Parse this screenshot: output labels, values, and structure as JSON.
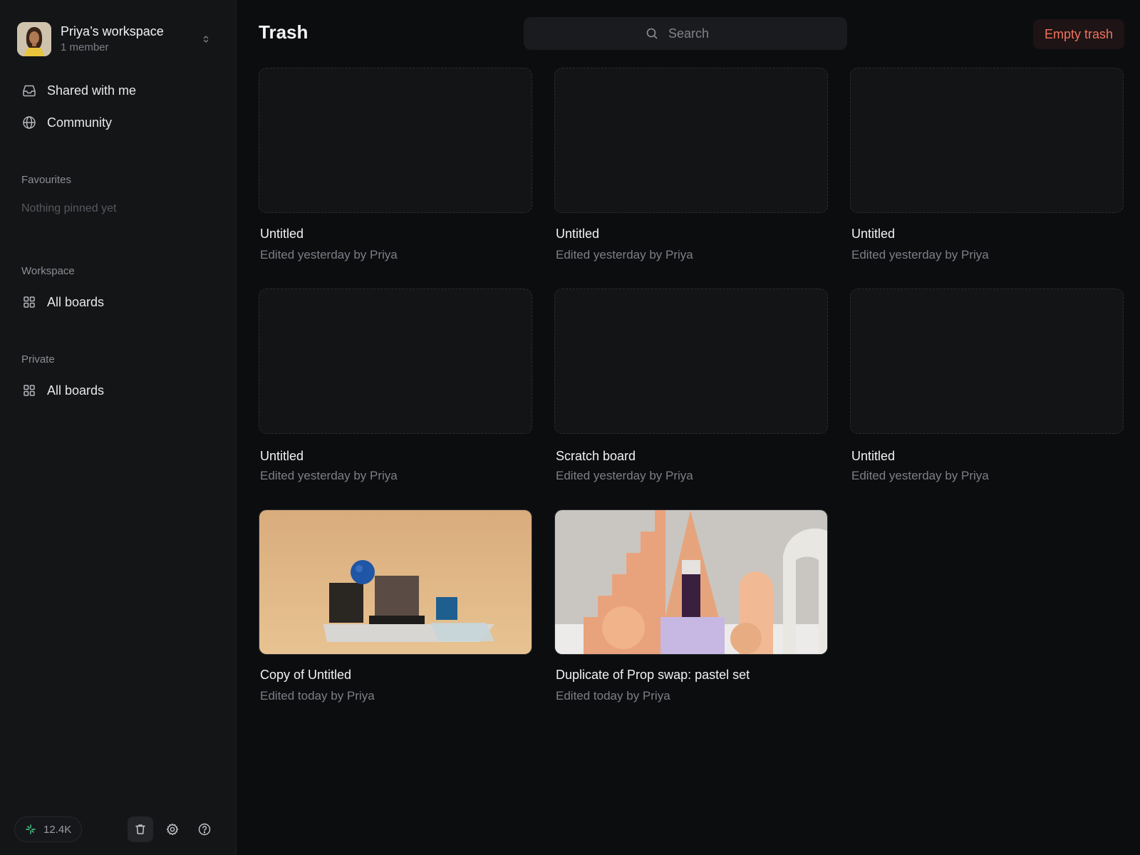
{
  "workspace": {
    "name": "Priya’s workspace",
    "members": "1 member"
  },
  "nav": {
    "shared": "Shared with me",
    "community": "Community"
  },
  "favourites": {
    "label": "Favourites",
    "empty": "Nothing pinned yet"
  },
  "workspace_section": {
    "label": "Workspace",
    "all_boards": "All boards"
  },
  "private_section": {
    "label": "Private",
    "all_boards": "All boards"
  },
  "footer": {
    "credits": "12.4K"
  },
  "header": {
    "title": "Trash",
    "search_placeholder": "Search",
    "empty_trash": "Empty trash"
  },
  "boards": [
    {
      "title": "Untitled",
      "meta": "Edited yesterday by Priya"
    },
    {
      "title": "Untitled",
      "meta": "Edited yesterday by Priya"
    },
    {
      "title": "Untitled",
      "meta": "Edited yesterday by Priya"
    },
    {
      "title": "Untitled",
      "meta": "Edited yesterday by Priya"
    },
    {
      "title": "Scratch board",
      "meta": "Edited yesterday by Priya"
    },
    {
      "title": "Untitled",
      "meta": "Edited yesterday by Priya"
    },
    {
      "title": "Copy of Untitled",
      "meta": "Edited today by Priya"
    },
    {
      "title": "Duplicate of Prop swap: pastel set",
      "meta": "Edited today by Priya"
    }
  ],
  "colors": {
    "background": "#0c0d0f",
    "sidebar": "#141517",
    "danger": "#f0735f"
  }
}
